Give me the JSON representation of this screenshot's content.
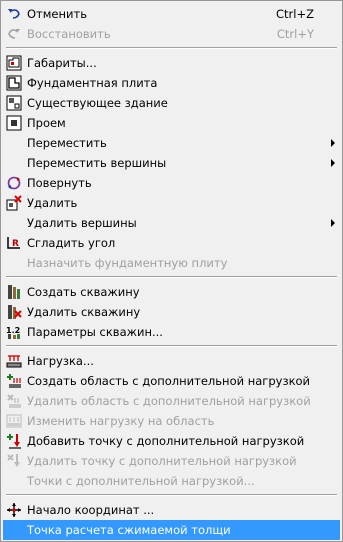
{
  "menu": {
    "items": [
      {
        "label": "Отменить",
        "shortcut": "Ctrl+Z",
        "icon": "undo-icon"
      },
      {
        "label": "Восстановить",
        "shortcut": "Ctrl+Y",
        "icon": "redo-icon"
      },
      {
        "label": "Габариты...",
        "icon": "dimensions-icon"
      },
      {
        "label": "Фундаментная плита",
        "icon": "foundation-plate-icon"
      },
      {
        "label": "Существующее здание",
        "icon": "existing-building-icon"
      },
      {
        "label": "Проем",
        "icon": "opening-icon"
      },
      {
        "label": "Переместить"
      },
      {
        "label": "Переместить вершины"
      },
      {
        "label": "Повернуть",
        "icon": "rotate-icon"
      },
      {
        "label": "Удалить",
        "icon": "delete-icon"
      },
      {
        "label": "Удалить вершины"
      },
      {
        "label": "Сгладить угол",
        "icon": "smooth-corner-icon"
      },
      {
        "label": "Назначить фундаментную плиту"
      },
      {
        "label": "Создать скважину",
        "icon": "create-borehole-icon"
      },
      {
        "label": "Удалить скважину",
        "icon": "delete-borehole-icon"
      },
      {
        "label": "Параметры скважин...",
        "icon": "borehole-params-icon"
      },
      {
        "label": "Нагрузка...",
        "icon": "load-icon"
      },
      {
        "label": "Создать область с дополнительной нагрузкой",
        "icon": "create-load-area-icon"
      },
      {
        "label": "Удалить область с дополнительной нагрузкой",
        "icon": "delete-load-area-icon"
      },
      {
        "label": "Изменить нагрузку на область",
        "icon": "edit-area-load-icon"
      },
      {
        "label": "Добавить точку с дополнительной нагрузкой",
        "icon": "add-load-point-icon"
      },
      {
        "label": "Удалить точку с дополнительной нагрузкой",
        "icon": "delete-load-point-icon"
      },
      {
        "label": "Точки с дополнительной нагрузкой..."
      },
      {
        "label": "Начало координат ...",
        "icon": "origin-icon"
      },
      {
        "label": "Точка расчета сжимаемой толщи"
      }
    ]
  },
  "colors": {
    "selection": "#3399ff",
    "disabled_text": "#a0a0a0",
    "menu_bg": "#f0f0f0"
  }
}
